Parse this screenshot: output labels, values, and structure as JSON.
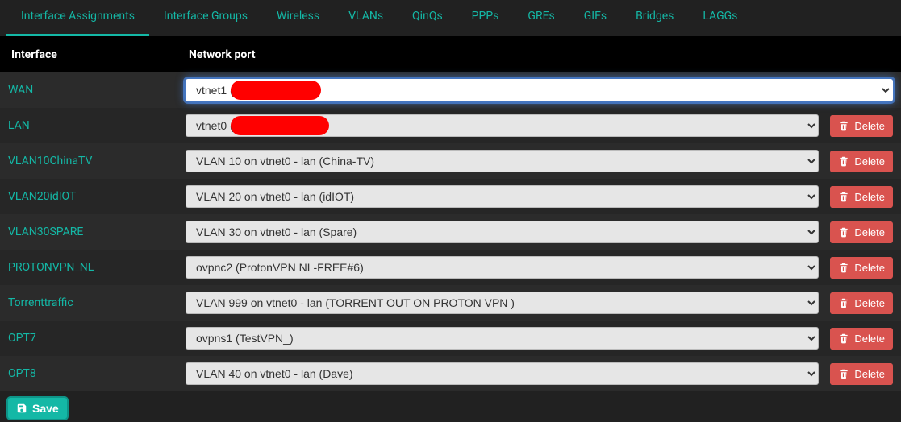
{
  "tabs": [
    {
      "label": "Interface Assignments",
      "active": true
    },
    {
      "label": "Interface Groups",
      "active": false
    },
    {
      "label": "Wireless",
      "active": false
    },
    {
      "label": "VLANs",
      "active": false
    },
    {
      "label": "QinQs",
      "active": false
    },
    {
      "label": "PPPs",
      "active": false
    },
    {
      "label": "GREs",
      "active": false
    },
    {
      "label": "GIFs",
      "active": false
    },
    {
      "label": "Bridges",
      "active": false
    },
    {
      "label": "LAGGs",
      "active": false
    }
  ],
  "columns": {
    "interface": "Interface",
    "port": "Network port"
  },
  "rows": [
    {
      "interface": "WAN",
      "port": "vtnet1 (",
      "deletable": false,
      "focused": true,
      "redact": "r1"
    },
    {
      "interface": "LAN",
      "port": "vtnet0 (",
      "deletable": true,
      "focused": false,
      "redact": "r2"
    },
    {
      "interface": "VLAN10ChinaTV",
      "port": "VLAN 10 on vtnet0 - lan (China-TV)",
      "deletable": true,
      "focused": false
    },
    {
      "interface": "VLAN20idIOT",
      "port": "VLAN 20 on vtnet0 - lan (idIOT)",
      "deletable": true,
      "focused": false
    },
    {
      "interface": "VLAN30SPARE",
      "port": "VLAN 30 on vtnet0 - lan (Spare)",
      "deletable": true,
      "focused": false
    },
    {
      "interface": "PROTONVPN_NL",
      "port": "ovpnc2 (ProtonVPN NL-FREE#6)",
      "deletable": true,
      "focused": false
    },
    {
      "interface": "Torrenttraffic",
      "port": "VLAN 999 on vtnet0 - lan (TORRENT OUT ON PROTON VPN )",
      "deletable": true,
      "focused": false
    },
    {
      "interface": "OPT7",
      "port": "ovpns1 (TestVPN_)",
      "deletable": true,
      "focused": false
    },
    {
      "interface": "OPT8",
      "port": "VLAN 40 on vtnet0 - lan (Dave)",
      "deletable": true,
      "focused": false
    }
  ],
  "buttons": {
    "delete": "Delete",
    "save": "Save"
  },
  "colors": {
    "accent": "#14b8a6",
    "danger": "#d9534f",
    "bg": "#212121"
  }
}
